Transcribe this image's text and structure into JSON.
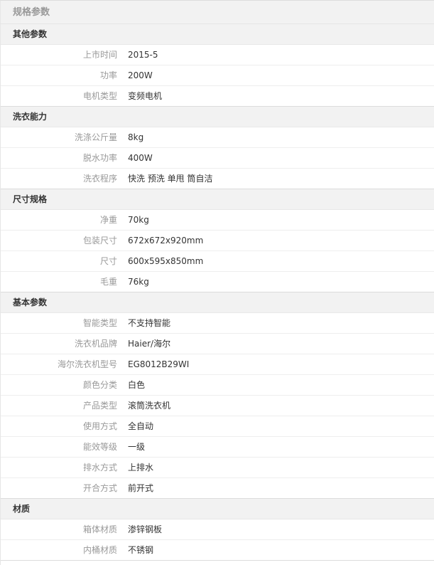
{
  "title": "规格参数",
  "groups": [
    {
      "name": "其他参数",
      "rows": [
        {
          "label": "上市时间",
          "value": "2015-5"
        },
        {
          "label": "功率",
          "value": "200W"
        },
        {
          "label": "电机类型",
          "value": "变频电机"
        }
      ]
    },
    {
      "name": "洗衣能力",
      "rows": [
        {
          "label": "洗涤公斤量",
          "value": "8kg"
        },
        {
          "label": "脱水功率",
          "value": "400W"
        },
        {
          "label": "洗衣程序",
          "value": "快洗 预洗 单甩 筒自洁"
        }
      ]
    },
    {
      "name": "尺寸规格",
      "rows": [
        {
          "label": "净重",
          "value": "70kg"
        },
        {
          "label": "包装尺寸",
          "value": "672x672x920mm"
        },
        {
          "label": "尺寸",
          "value": "600x595x850mm"
        },
        {
          "label": "毛重",
          "value": "76kg"
        }
      ]
    },
    {
      "name": "基本参数",
      "rows": [
        {
          "label": "智能类型",
          "value": "不支持智能"
        },
        {
          "label": "洗衣机品牌",
          "value": "Haier/海尔"
        },
        {
          "label": "海尔洗衣机型号",
          "value": "EG8012B29WI"
        },
        {
          "label": "颜色分类",
          "value": "白色"
        },
        {
          "label": "产品类型",
          "value": "滚筒洗衣机"
        },
        {
          "label": "使用方式",
          "value": "全自动"
        },
        {
          "label": "能效等级",
          "value": "一级"
        },
        {
          "label": "排水方式",
          "value": "上排水"
        },
        {
          "label": "开合方式",
          "value": "前开式"
        }
      ]
    },
    {
      "name": "材质",
      "rows": [
        {
          "label": "箱体材质",
          "value": "渗锌钢板"
        },
        {
          "label": "内桶材质",
          "value": "不锈钢"
        }
      ]
    }
  ]
}
